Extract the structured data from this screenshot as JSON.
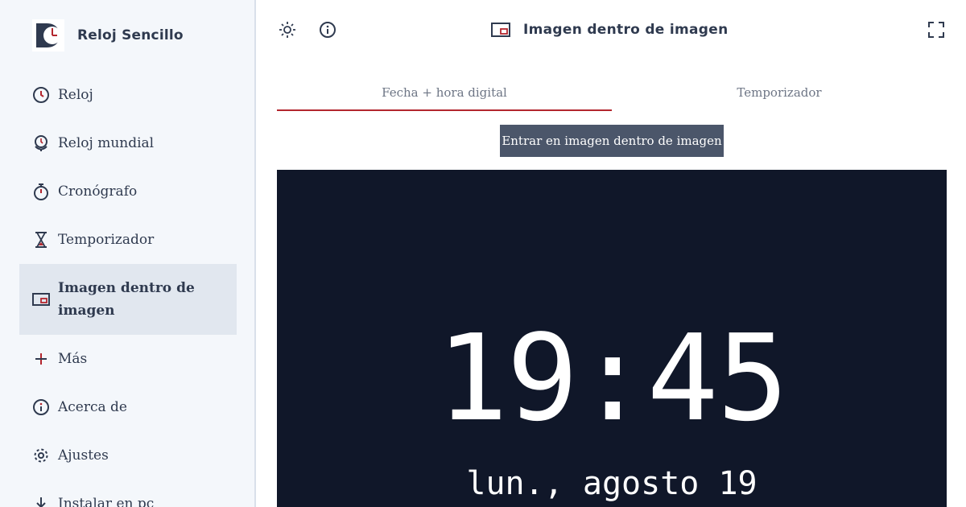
{
  "app": {
    "name": "Reloj Sencillo",
    "accent": "#b3262e"
  },
  "sidebar": {
    "items": [
      {
        "label": "Reloj",
        "icon": "clock-icon"
      },
      {
        "label": "Reloj mundial",
        "icon": "world-clock-icon"
      },
      {
        "label": "Cronógrafo",
        "icon": "stopwatch-icon"
      },
      {
        "label": "Temporizador",
        "icon": "hourglass-icon"
      },
      {
        "label": "Imagen dentro de imagen",
        "icon": "picture-in-picture-icon",
        "active": true
      },
      {
        "label": "Más",
        "icon": "plus-icon"
      },
      {
        "label": "Acerca de",
        "icon": "info-icon"
      },
      {
        "label": "Ajustes",
        "icon": "gear-icon"
      },
      {
        "label": "Instalar en pc",
        "icon": "download-icon"
      }
    ]
  },
  "header": {
    "title": "Imagen dentro de imagen",
    "icons": [
      "theme-toggle-icon",
      "info-icon",
      "fullscreen-icon"
    ]
  },
  "tabs": [
    {
      "label": "Fecha + hora digital",
      "active": true
    },
    {
      "label": "Temporizador",
      "active": false
    }
  ],
  "pip_button": {
    "label": "Entrar en imagen dentro de imagen"
  },
  "clock": {
    "time": "19:45",
    "date": "lun., agosto 19"
  }
}
